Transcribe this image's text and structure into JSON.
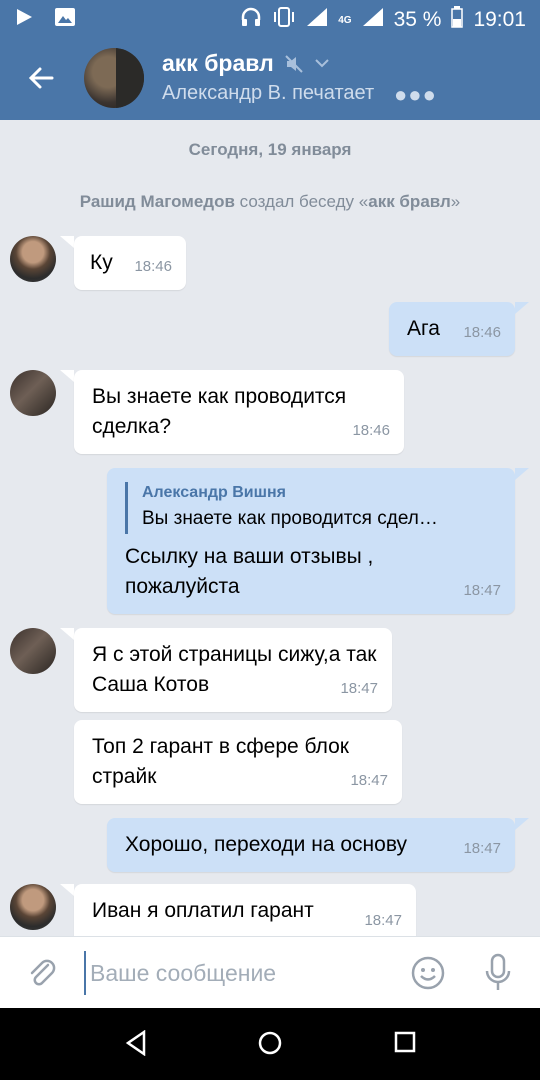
{
  "status_bar": {
    "battery": "35 %",
    "time": "19:01",
    "network": "4G"
  },
  "header": {
    "title": "акк бравл",
    "subtitle": "Александр В. печатает",
    "typing_dots": "●●●"
  },
  "chat": {
    "date_divider": "Сегодня, 19 января",
    "system_message": {
      "actor": "Рашид Магомедов",
      "action": " создал беседу «",
      "chat_name": "акк бравл",
      "close": "»"
    },
    "messages": [
      {
        "id": "m1",
        "direction": "in",
        "avatar": "ronaldo",
        "text": "Ку",
        "time": "18:46"
      },
      {
        "id": "m2",
        "direction": "out",
        "text": "Ага",
        "time": "18:46"
      },
      {
        "id": "m3",
        "direction": "in",
        "avatar": "dark",
        "text": "Вы знаете как проводится сделка?",
        "time": "18:46"
      },
      {
        "id": "m4",
        "direction": "out",
        "reply_to": {
          "author": "Александр Вишня",
          "text": "Вы знаете как проводится сдел…"
        },
        "text": "Ссылку на ваши отзывы , пожалуйста",
        "time": "18:47"
      },
      {
        "id": "m5",
        "direction": "in",
        "avatar": "dark",
        "text": "Я с этой страницы сижу,а так Саша Котов",
        "time": "18:47"
      },
      {
        "id": "m6",
        "direction": "in",
        "text": "Топ 2 гарант в сфере блок страйк",
        "time": "18:47"
      },
      {
        "id": "m7",
        "direction": "out",
        "text": "Хорошо, переходи на основу",
        "time": "18:47"
      },
      {
        "id": "m8",
        "direction": "in",
        "avatar": "ronaldo",
        "text": "Иван я оплатил гарант",
        "time": "18:47"
      }
    ]
  },
  "composer": {
    "placeholder": "Ваше сообщение",
    "value": ""
  },
  "colors": {
    "brand": "#4a76a8",
    "chat_bg": "#e6e9ee",
    "outgoing_bubble": "#cce0f7",
    "incoming_bubble": "#ffffff",
    "meta_text": "#818c99"
  }
}
